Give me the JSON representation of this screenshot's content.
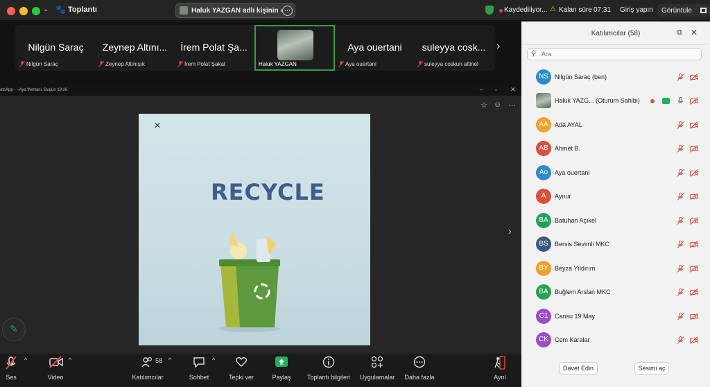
{
  "titlebar": {
    "title": "Toplantı",
    "share_pill": "Haluk YAZGAN adlı kişinin ekranı",
    "recording": "Kaydediliyor...",
    "time_label": "Kalan süre",
    "time_value": "07:31",
    "signin": "Giriş yapın",
    "view": "Görüntüle"
  },
  "filmstrip": [
    {
      "big": "Nilgün Saraç",
      "small": "Nilgün Saraç"
    },
    {
      "big": "Zeynep Altını...",
      "small": "Zeynep Altınışık"
    },
    {
      "big": "İrem Polat Şa...",
      "small": "İrem Polat Şakal"
    },
    {
      "big": "",
      "small": "Haluk YAZGAN"
    },
    {
      "big": "Aya ouertani",
      "small": "Aya ouertani"
    },
    {
      "big": "suleyya cosk...",
      "small": "suleyya coskun altinel"
    }
  ],
  "shared": {
    "window_title": "atsApp - ~Aya Wertani, Bugün 19:26",
    "image_text": "RECYCLE"
  },
  "participants": {
    "title": "Katılımcılar (58)",
    "search_placeholder": "Ara",
    "rows": [
      {
        "initials": "NS",
        "name": "Nilgün Saraç (ben)",
        "color": "#2d8bc9"
      },
      {
        "initials": "",
        "name": "Haluk YAZG...  (Oturum Sahibi)",
        "color": "#7a8a7a"
      },
      {
        "initials": "AA",
        "name": "Ada AYAL",
        "color": "#f0a22a"
      },
      {
        "initials": "AB",
        "name": "Ahmet B.",
        "color": "#d8503f"
      },
      {
        "initials": "Ao",
        "name": "Aya ouertani",
        "color": "#2d8bc9"
      },
      {
        "initials": "A",
        "name": "Aynur",
        "color": "#d8503f"
      },
      {
        "initials": "BA",
        "name": "Batuhan Açıkel",
        "color": "#27a05a"
      },
      {
        "initials": "BS",
        "name": "Bersis Sevimli MKC",
        "color": "#3d5a80"
      },
      {
        "initials": "BY",
        "name": "Beyza Yıldırım",
        "color": "#f0a22a"
      },
      {
        "initials": "BA",
        "name": "Buğlem Arslan MKC",
        "color": "#27a05a"
      },
      {
        "initials": "C1",
        "name": "Cansu 19 May",
        "color": "#9b4fc4"
      },
      {
        "initials": "CK",
        "name": "Cem Karalar",
        "color": "#9b4fc4"
      }
    ],
    "invite": "Davet Edin",
    "unmute": "Sesimi aç"
  },
  "toolbar": {
    "audio": "Ses",
    "video": "Video",
    "participants": "Katılımcılar",
    "participants_count": "58",
    "chat": "Sohbet",
    "react": "Tepki ver",
    "share": "Paylaş",
    "info": "Toplantı bilgileri",
    "apps": "Uygulamalar",
    "more": "Daha fazla",
    "leave": "Ayrıl"
  },
  "colors": {
    "accent": "#2ea043",
    "mute_red": "#e0473b",
    "share_green": "#22b05a"
  }
}
